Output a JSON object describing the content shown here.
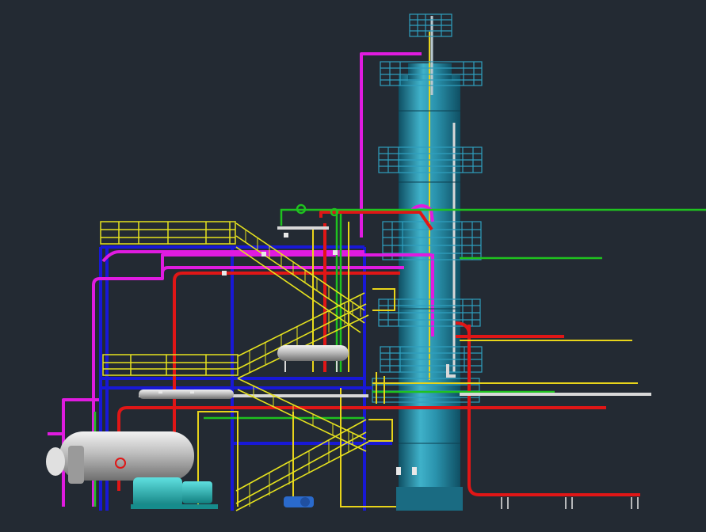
{
  "scene": {
    "background": "#232a33",
    "description_visible_text": ""
  },
  "colors": {
    "column_body": "#1f7f99",
    "column_highlight": "#3fb1c9",
    "column_shadow": "#0f4f63",
    "platform": "#2f9fbf",
    "structure_steel": "#1818d6",
    "stair_yellow": "#e6e21e",
    "pipe_magenta": "#e01be0",
    "pipe_red": "#e01616",
    "pipe_yellow": "#e8d41a",
    "pipe_green": "#1fc21f",
    "pipe_white": "#d8d8d8",
    "vessel_silver": "#cfcfcf",
    "pump_teal": "#20bfbf",
    "support_white": "#e8e8e8"
  }
}
